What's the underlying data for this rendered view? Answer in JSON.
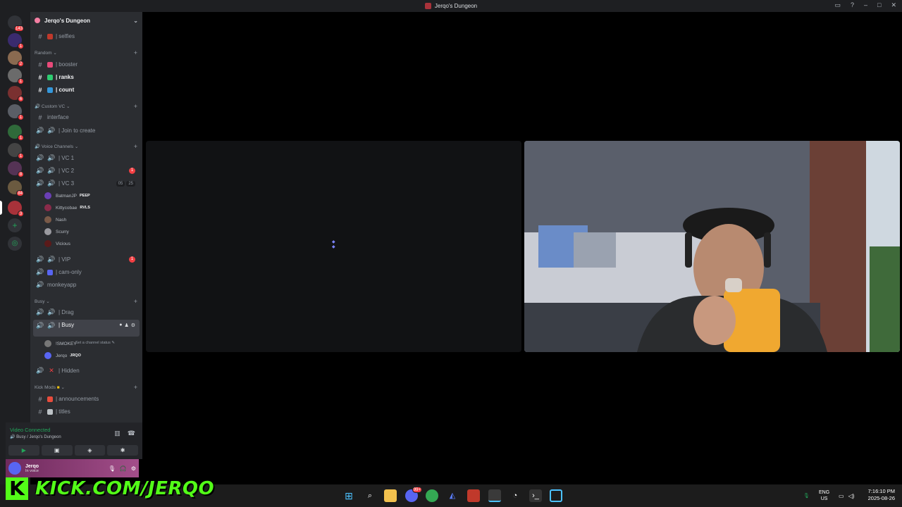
{
  "window": {
    "title": "Jerqo's Dungeon"
  },
  "guilds": [
    {
      "badge": "143"
    },
    {
      "badge": "1"
    },
    {
      "badge": "2"
    },
    {
      "badge": "1"
    },
    {
      "badge": "6"
    },
    {
      "badge": "1"
    },
    {
      "badge": "1"
    },
    {
      "badge": "1"
    },
    {
      "badge": "8"
    },
    {
      "badge": "84"
    },
    {
      "badge": "3"
    }
  ],
  "server": {
    "name": "Jerqo's Dungeon"
  },
  "channels": {
    "selfies": "| selfies",
    "cat_random": "Random",
    "booster": "| booster",
    "ranks": "| ranks",
    "count": "| count",
    "cat_custom_vc": "Custom VC",
    "interface": "interface",
    "join_to_create": "| Join to create",
    "cat_voice": "Voice Channels",
    "vc1": "| VC 1",
    "vc2": "| VC 2",
    "vc2_badge": "1",
    "vc3": "| VC 3",
    "vc3_pill_a": "05",
    "vc3_pill_b": "25",
    "vip": "| VIP",
    "vip_badge": "1",
    "cam_only": "| cam-only",
    "monkeyapp": "monkeyapp",
    "cat_busy": "Busy",
    "drag": "| Drag",
    "busy": "| Busy",
    "busy_status": "Set a channel status",
    "hidden": "| Hidden",
    "cat_kick_mods": "Kick Mods",
    "announcements": "| announcements",
    "titles": "| titles"
  },
  "vc3_users": [
    {
      "name": "BatmanJP",
      "tag": "PEEP",
      "color": "#6a3fb5"
    },
    {
      "name": "Kittycobae",
      "tag": "RVLS",
      "color": "#8a2b4a"
    },
    {
      "name": "Nash",
      "tag": "",
      "color": "#7a5a48"
    },
    {
      "name": "Scurry",
      "tag": "",
      "color": "#9a9aa0"
    },
    {
      "name": "Vicious",
      "tag": "",
      "color": "#5a1a1a"
    }
  ],
  "busy_users": [
    {
      "name": "!SMOKEY",
      "tag": "",
      "color": "#777777"
    },
    {
      "name": "Jerqo",
      "tag": "JRQO",
      "color": "#5865f2"
    }
  ],
  "voice_connection": {
    "status": "Video Connected",
    "location": "Busy / Jerqo's Dungeon"
  },
  "user_panel": {
    "name": "Jerqo",
    "status": "In voice"
  },
  "overlay": {
    "kick_url": "KICK.COM/JERQO"
  },
  "taskbar": {
    "lang_top": "ENG",
    "lang_bottom": "US",
    "time": "7:16:10 PM",
    "date": "2025-08-26",
    "discord_badge": "99+"
  },
  "colors": {
    "accent": "#5865f2",
    "online": "#23a55a",
    "mention": "#f23f43",
    "kick": "#53fc18"
  }
}
